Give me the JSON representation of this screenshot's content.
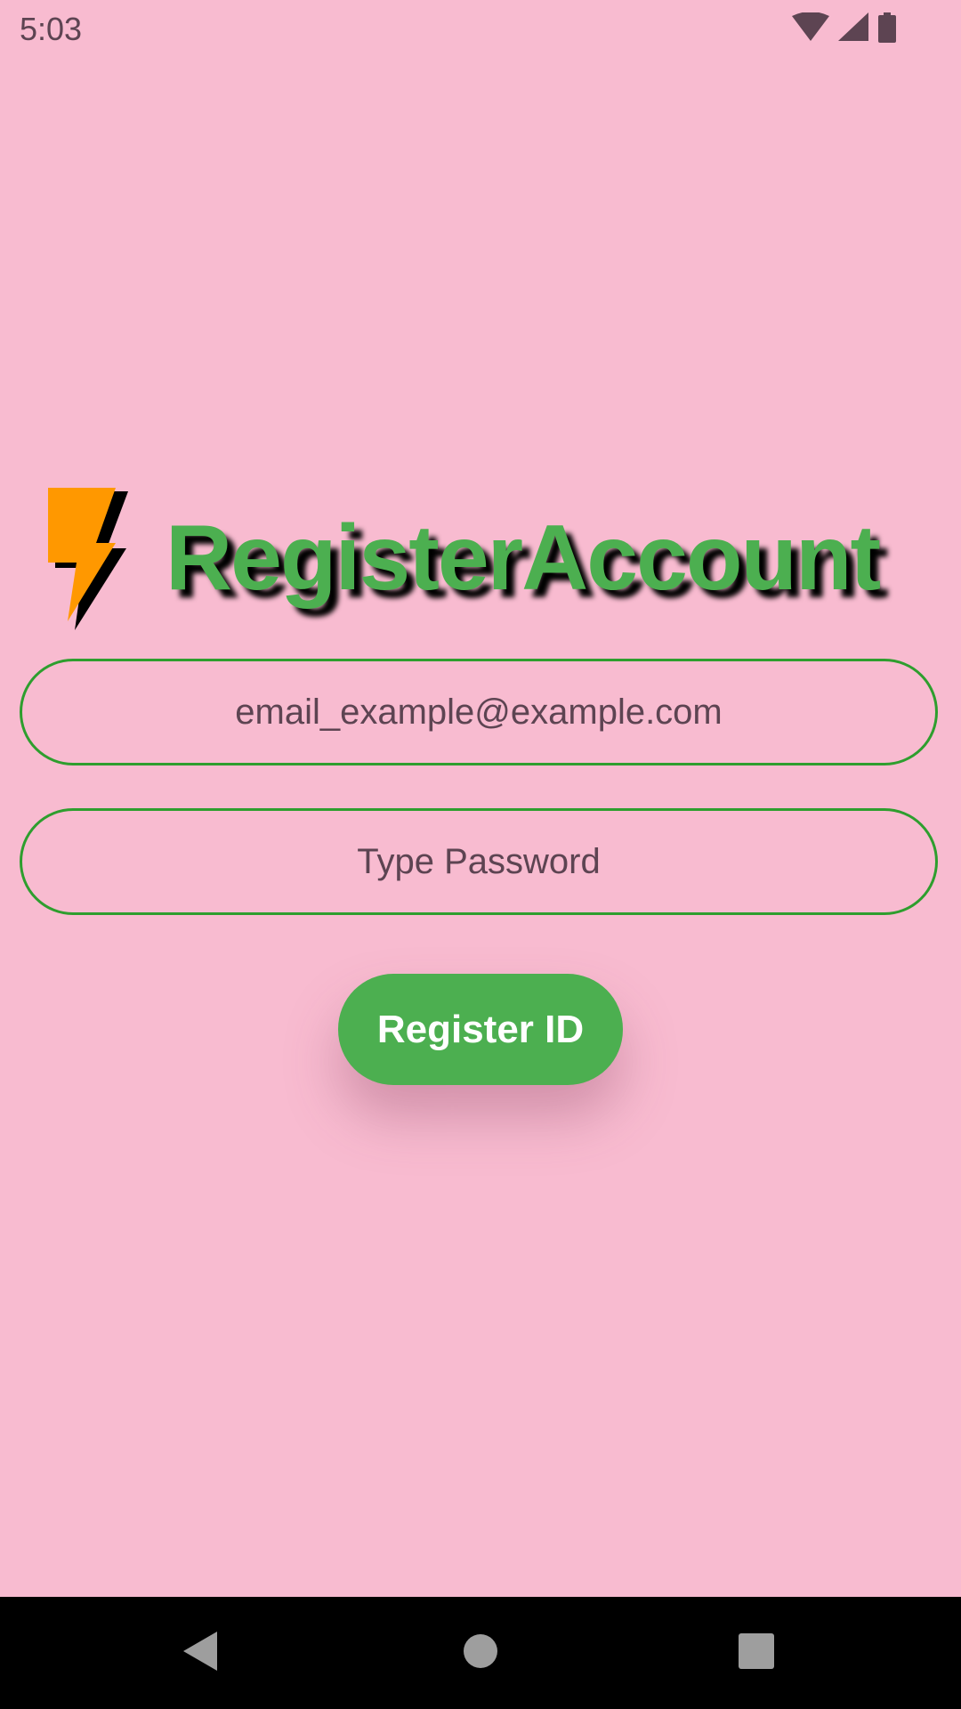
{
  "status_bar": {
    "time": "5:03",
    "icons": [
      "wifi-icon",
      "cellular-signal-icon",
      "battery-icon"
    ]
  },
  "header": {
    "logo_icon": "lightning-bolt-icon",
    "title": "RegisterAccount"
  },
  "form": {
    "email_placeholder": "email_example@example.com",
    "email_value": "",
    "password_placeholder": "Type Password",
    "password_value": "",
    "register_label": "Register ID"
  },
  "nav_bar": {
    "buttons": [
      "back-icon",
      "home-icon",
      "recents-icon"
    ]
  },
  "colors": {
    "background": "#f8bbd0",
    "title": "#4caf50",
    "input_border": "#2e9e2e",
    "button": "#4caf50",
    "bolt": "#ff9800",
    "text": "#5d4452"
  }
}
